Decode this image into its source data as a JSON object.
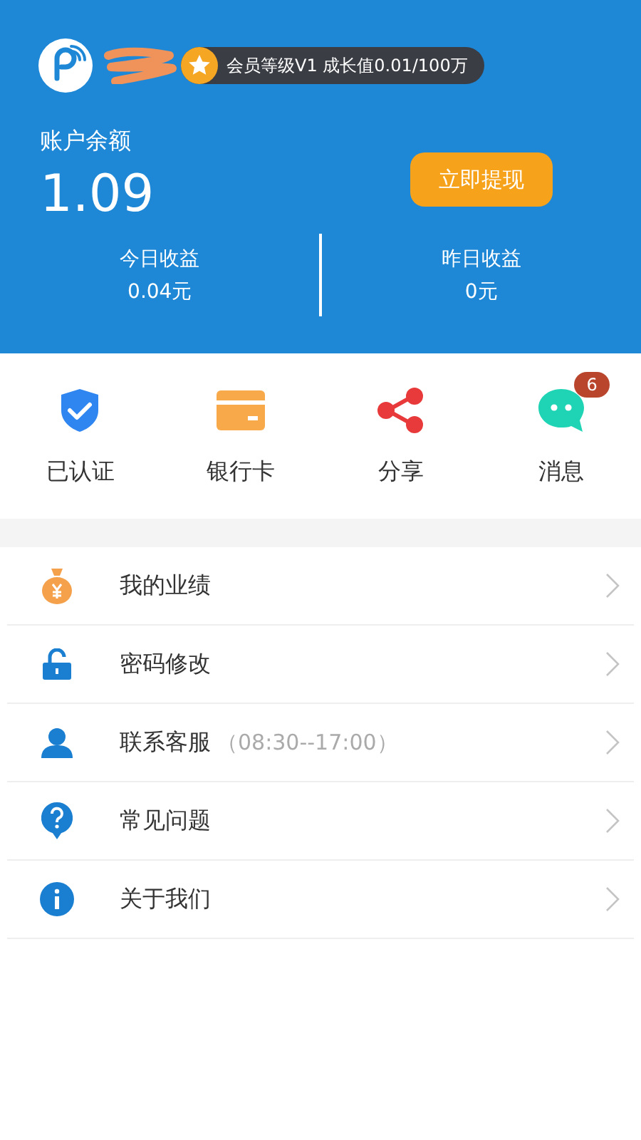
{
  "profile": {
    "level_badge": "会员等级V1  成长值0.01/100万"
  },
  "balance": {
    "label": "账户余额",
    "amount": "1.09",
    "withdraw_button": "立即提现"
  },
  "earnings": [
    {
      "label": "今日收益",
      "value": "0.04元"
    },
    {
      "label": "昨日收益",
      "value": "0元"
    }
  ],
  "shortcuts": [
    {
      "kind": "shield",
      "label": "已认证"
    },
    {
      "kind": "card",
      "label": "银行卡"
    },
    {
      "kind": "share",
      "label": "分享"
    },
    {
      "kind": "chat",
      "label": "消息",
      "badge": "6"
    }
  ],
  "menu": [
    {
      "kind": "moneybag",
      "label": "我的业绩"
    },
    {
      "kind": "lock",
      "label": "密码修改"
    },
    {
      "kind": "agent",
      "label": "联系客服",
      "hint": "（08:30--17:00）"
    },
    {
      "kind": "question",
      "label": "常见问题"
    },
    {
      "kind": "info",
      "label": "关于我们"
    }
  ]
}
